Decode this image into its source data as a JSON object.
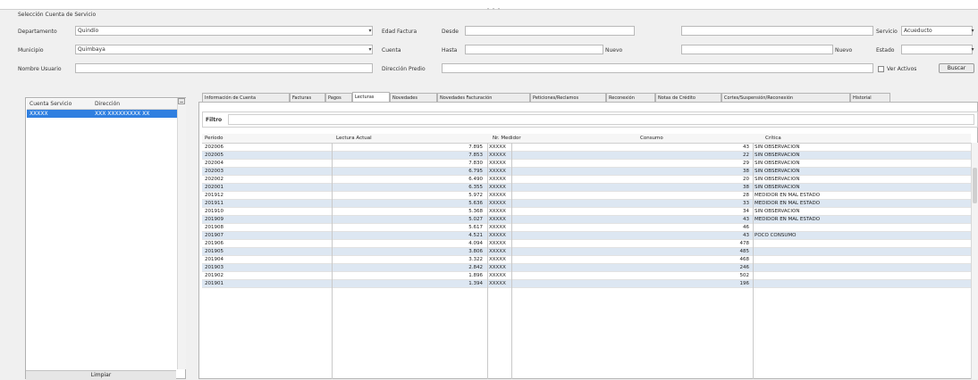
{
  "topbar": {
    "title": "Selección Cuenta de Servicio"
  },
  "filters": {
    "departamento_label": "Departamento",
    "departamento_value": "Quindío",
    "municipio_label": "Municipio",
    "municipio_value": "Quimbaya",
    "nombre_label": "Nombre Usuario",
    "nombre_value": "",
    "edad_factura_label": "Edad Factura",
    "desde_label": "Desde",
    "cuenta_label": "Cuenta",
    "hasta_label": "Hasta",
    "direccion_label": "Dirección Predio",
    "nuevo_label": "Nuevo",
    "nuevo_right_label": "Nuevo",
    "servicio_label": "Servicio",
    "servicio_value": "Acueducto",
    "estado_label": "Estado",
    "estado_value": "",
    "ver_activos_label": "Ver Activos",
    "buscar_label": "Buscar"
  },
  "left": {
    "col1": "Cuenta Servicio",
    "col2": "Dirección",
    "selected_cuenta": "XXXXX",
    "selected_dir": "XXX XXXXXXXXX XX",
    "footer": "Limpiar"
  },
  "tabs": [
    "Información de Cuenta",
    "Facturas",
    "Pagos",
    "Lecturas",
    "Novedades",
    "Novedades Facturación",
    "Peticiones/Reclamos",
    "Reconexión",
    "Notas de Crédito",
    "Cortes/Suspensión/Reconexión",
    "Historial"
  ],
  "filtro_label": "Filtro",
  "grid": {
    "headers": [
      "Período",
      "Lectura Actual",
      "Nr. Medidor",
      "Consumo",
      "Crítica"
    ],
    "rows": [
      [
        "202006",
        "7.895",
        "XXXXX",
        "43",
        "SIN OBSERVACION"
      ],
      [
        "202005",
        "7.853",
        "XXXXX",
        "22",
        "SIN OBSERVACION"
      ],
      [
        "202004",
        "7.830",
        "XXXXX",
        "29",
        "SIN OBSERVACION"
      ],
      [
        "202003",
        "6.795",
        "XXXXX",
        "38",
        "SIN OBSERVACION"
      ],
      [
        "202002",
        "6.490",
        "XXXXX",
        "20",
        "SIN OBSERVACION"
      ],
      [
        "202001",
        "6.355",
        "XXXXX",
        "38",
        "SIN OBSERVACION"
      ],
      [
        "201912",
        "5.972",
        "XXXXX",
        "28",
        "MEDIDOR EN MAL ESTADO"
      ],
      [
        "201911",
        "5.636",
        "XXXXX",
        "33",
        "MEDIDOR EN MAL ESTADO"
      ],
      [
        "201910",
        "5.368",
        "XXXXX",
        "34",
        "SIN OBSERVACION"
      ],
      [
        "201909",
        "5.027",
        "XXXXX",
        "43",
        "MEDIDOR EN MAL ESTADO"
      ],
      [
        "201908",
        "5.617",
        "XXXXX",
        "46",
        ""
      ],
      [
        "201907",
        "4.521",
        "XXXXX",
        "43",
        "POCO CONSUMO"
      ],
      [
        "201906",
        "4.094",
        "XXXXX",
        "478",
        ""
      ],
      [
        "201905",
        "3.806",
        "XXXXX",
        "485",
        ""
      ],
      [
        "201904",
        "3.322",
        "XXXXX",
        "468",
        ""
      ],
      [
        "201903",
        "2.842",
        "XXXXX",
        "246",
        ""
      ],
      [
        "201902",
        "1.896",
        "XXXXX",
        "502",
        ""
      ],
      [
        "201901",
        "1.394",
        "XXXXX",
        "196",
        ""
      ]
    ]
  },
  "colors": {
    "selection": "#2f7fe0",
    "row_alt": "#dde7f2",
    "frame": "#f0f0f0"
  },
  "icons": {
    "dropdown": "chevron-down-icon",
    "collapse": "minus-icon"
  }
}
